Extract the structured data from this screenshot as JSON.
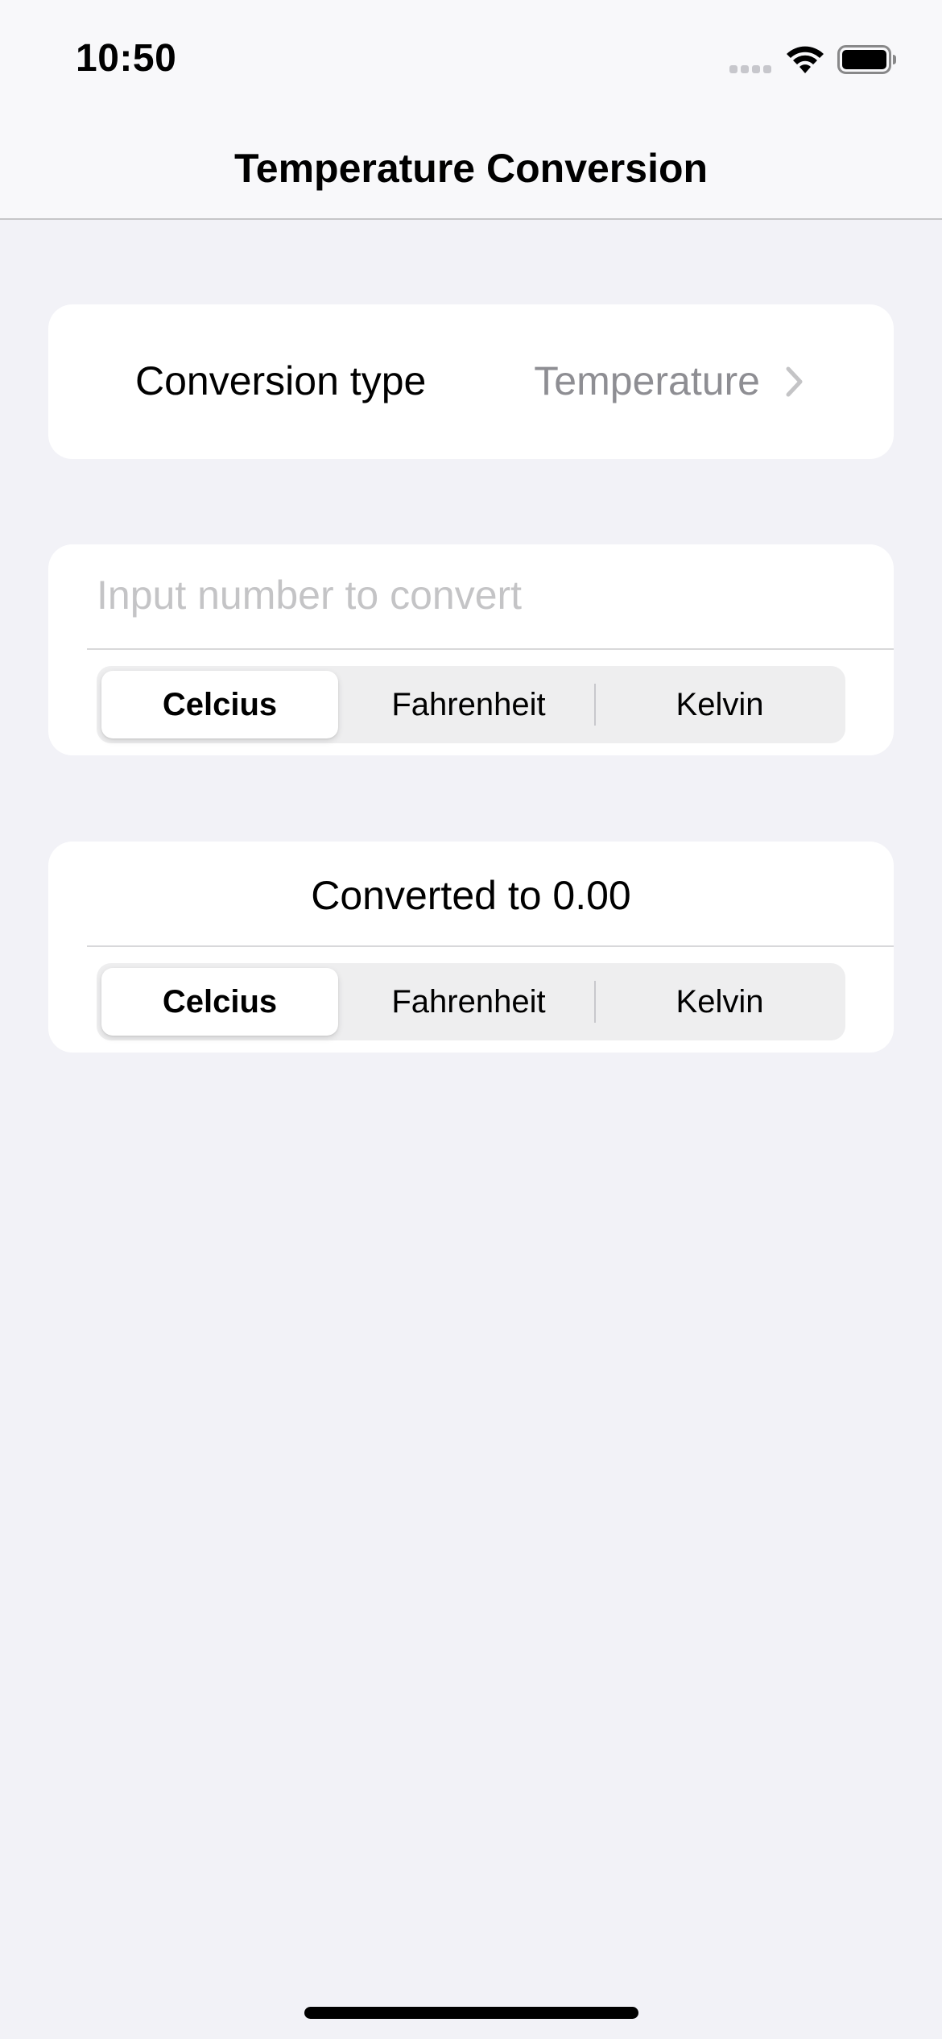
{
  "status_bar": {
    "time": "10:50",
    "icons": [
      "cellular-signal-icon",
      "wifi-icon",
      "battery-icon"
    ]
  },
  "nav": {
    "title": "Temperature Conversion"
  },
  "conversion_type": {
    "label": "Conversion type",
    "value": "Temperature",
    "icon": "chevron-right-icon"
  },
  "input": {
    "value": "",
    "placeholder": "Input number to convert",
    "units": [
      "Celcius",
      "Fahrenheit",
      "Kelvin"
    ],
    "selected": "Celcius"
  },
  "output": {
    "result": "Converted to 0.00",
    "units": [
      "Celcius",
      "Fahrenheit",
      "Kelvin"
    ],
    "selected": "Celcius"
  },
  "colors": {
    "background": "#F2F2F7",
    "card": "#FFFFFF",
    "secondary_text": "#8E8E93",
    "placeholder": "#C4C4C6",
    "segment_track": "#EEEEEF"
  }
}
